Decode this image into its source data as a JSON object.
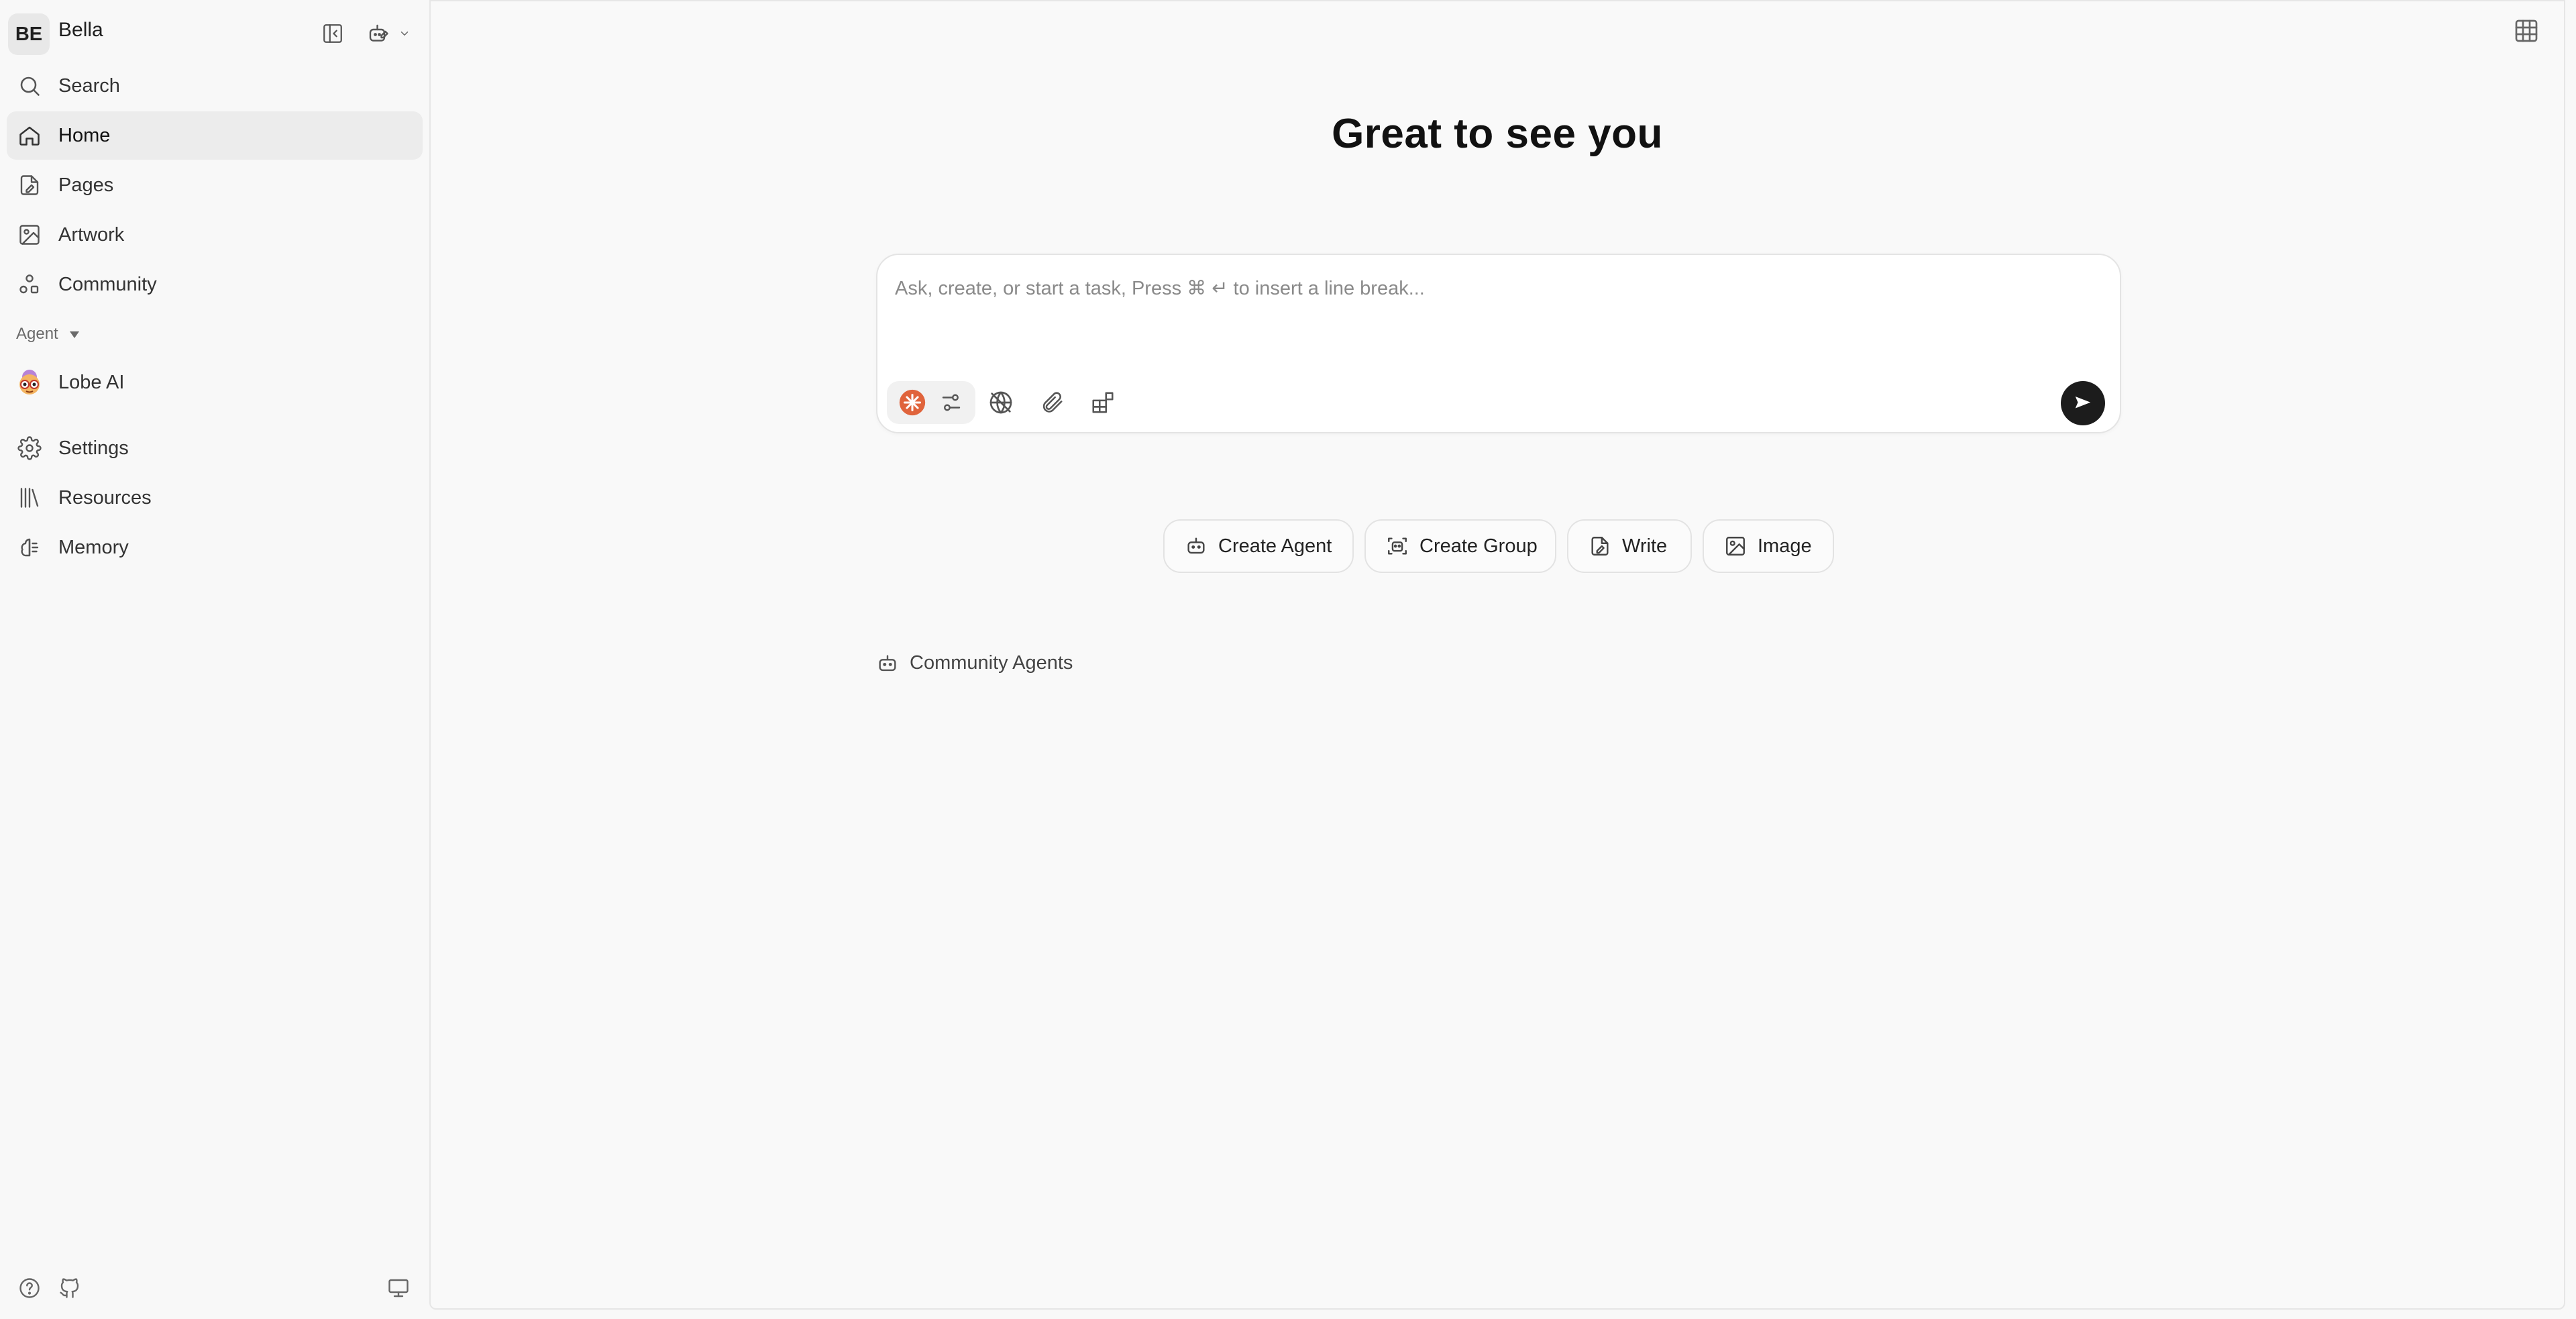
{
  "user": {
    "initials": "BE",
    "name": "Bella"
  },
  "sidebar": {
    "nav": [
      {
        "label": "Search",
        "icon": "search-icon"
      },
      {
        "label": "Home",
        "icon": "home-icon",
        "active": true
      },
      {
        "label": "Pages",
        "icon": "pages-icon"
      },
      {
        "label": "Artwork",
        "icon": "artwork-icon"
      },
      {
        "label": "Community",
        "icon": "community-icon"
      }
    ],
    "agent_section_label": "Agent",
    "agents": [
      {
        "label": "Lobe AI",
        "icon": "lobe-ai-avatar"
      }
    ],
    "bottom_nav": [
      {
        "label": "Settings",
        "icon": "settings-icon"
      },
      {
        "label": "Resources",
        "icon": "resources-icon"
      },
      {
        "label": "Memory",
        "icon": "memory-icon"
      }
    ]
  },
  "main": {
    "greeting": "Great to see you",
    "composer": {
      "placeholder": "Ask, create, or start a task, Press ⌘ ↵ to insert a line break..."
    },
    "actions": [
      {
        "label": "Create Agent",
        "icon": "robot-icon"
      },
      {
        "label": "Create Group",
        "icon": "group-bot-icon"
      },
      {
        "label": "Write",
        "icon": "write-icon"
      },
      {
        "label": "Image",
        "icon": "image-icon"
      }
    ],
    "community_agents_label": "Community Agents"
  },
  "colors": {
    "background": "#f8f8f8",
    "active_nav": "#ececec",
    "send_button": "#1c1c1c",
    "model_badge": "#e0643c"
  }
}
